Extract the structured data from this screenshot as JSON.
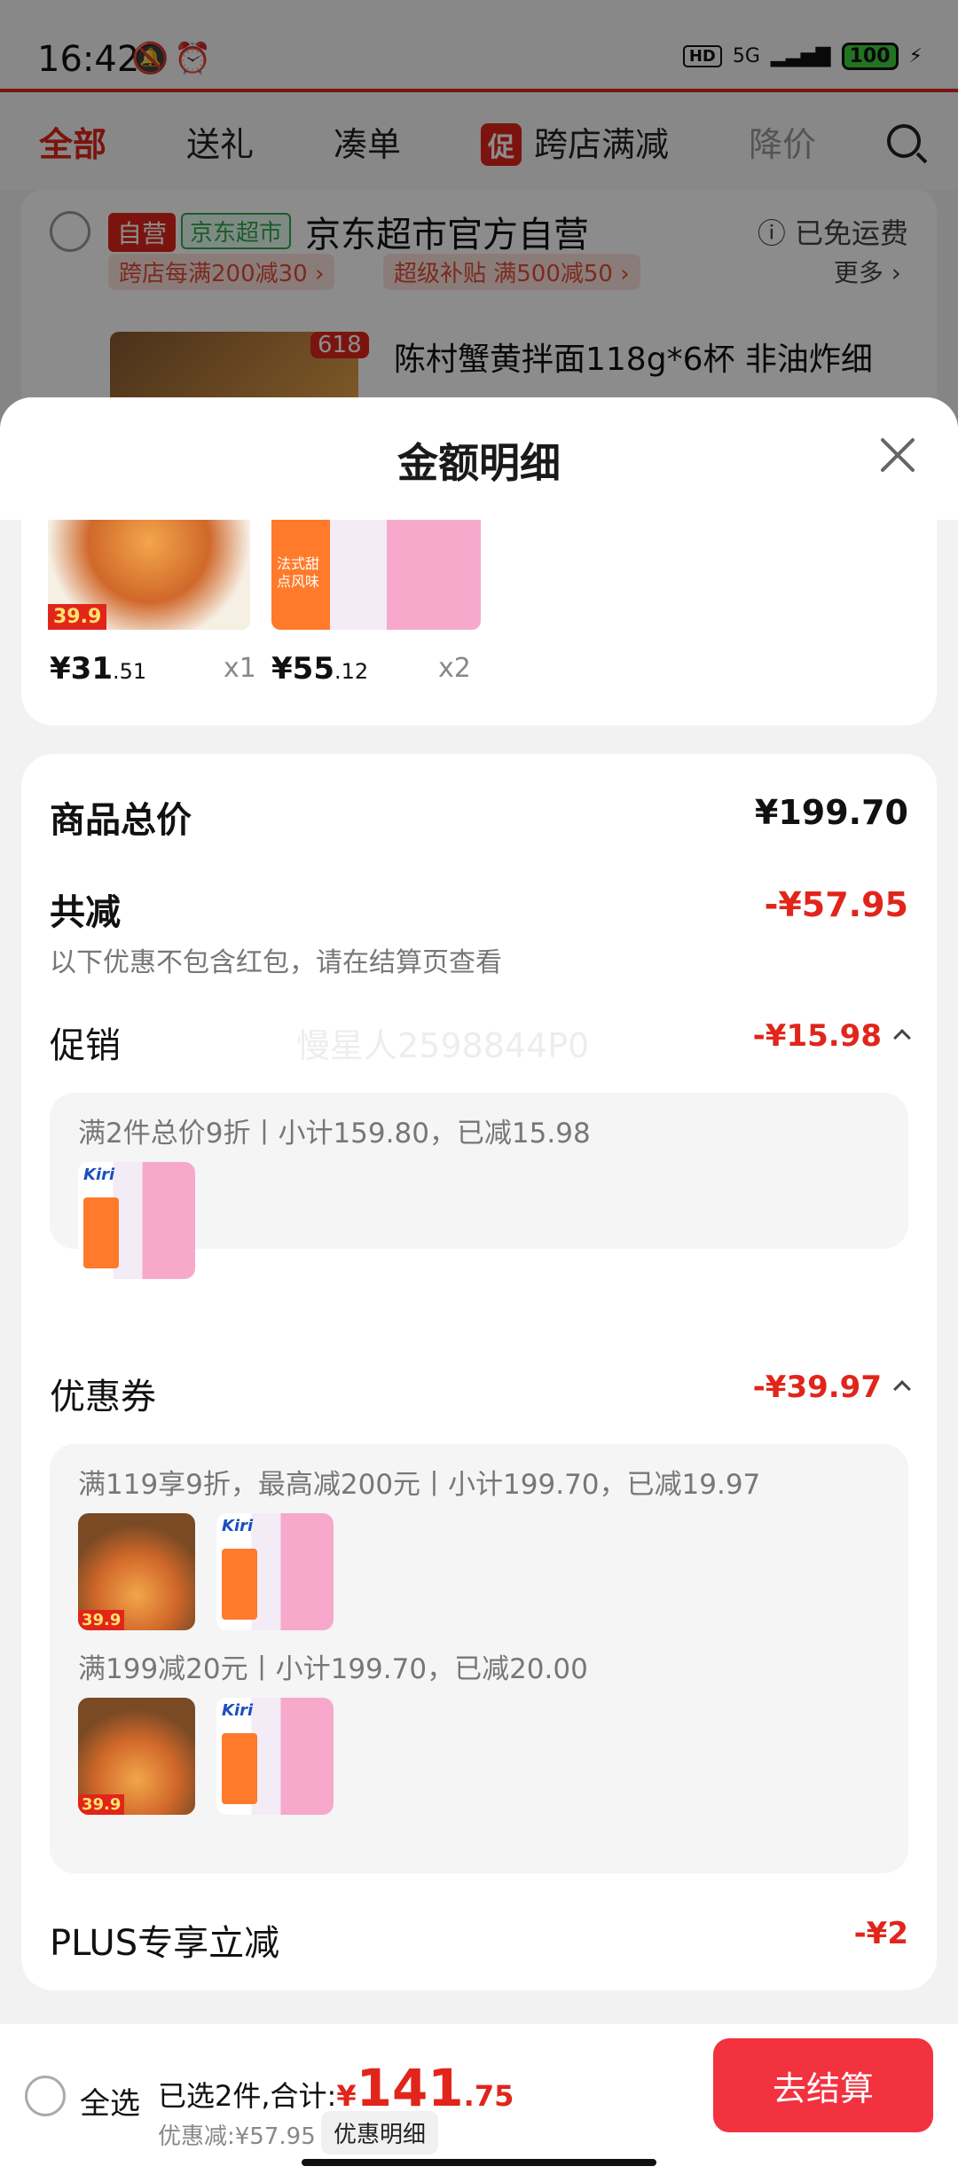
{
  "status": {
    "time": "16:42",
    "hd": "HD",
    "net": "5G",
    "battery": "100"
  },
  "tabs": [
    {
      "label": "全部"
    },
    {
      "label": "送礼"
    },
    {
      "label": "凑单"
    },
    {
      "label": "跨店满减",
      "badge": "促"
    },
    {
      "label": "降价"
    }
  ],
  "store": {
    "tag_self": "自营",
    "tag_jd": "京东超市",
    "name": "京东超市官方自营",
    "free_ship": "ⓘ 已免运费",
    "coupon1": "跨店每满200减30 ›",
    "coupon2": "超级补贴 满500减50 ›",
    "more": "更多 ›",
    "product_badge": "618",
    "product_title": "陈村蟹黄拌面118g*6杯 非油炸细"
  },
  "sheet": {
    "title": "金额明细",
    "goods": [
      {
        "price_int": "¥31",
        "price_dec": ".51",
        "qty": "x1",
        "tag": "39.9"
      },
      {
        "price_int": "¥55",
        "price_dec": ".12",
        "qty": "x2",
        "tag": "法式甜点风味"
      }
    ],
    "total_label": "商品总价",
    "total_value": "¥199.70",
    "reduce_label": "共减",
    "reduce_value": "-¥57.95",
    "reduce_note": "以下优惠不包含红包，请在结算页查看",
    "watermark": "慢星人2598844P0",
    "promo_label": "促销",
    "promo_value": "-¥15.98",
    "promo_rule": "满2件总价9折丨小计159.80，已减15.98",
    "coupon_label": "优惠券",
    "coupon_value": "-¥39.97",
    "coupon_rule1": "满119享9折，最高减200元丨小计199.70，已减19.97",
    "coupon_rule2": "满199减20元丨小计199.70，已减20.00",
    "plus_label": "PLUS专享立减",
    "plus_value": "-¥2",
    "kiri_logo": "Kiri",
    "noodle_tag": "39.9"
  },
  "footer": {
    "select_all": "全选",
    "summary_prefix": "已选2件,合计:",
    "currency": "¥",
    "total_int": "141",
    "total_dec": ".75",
    "discount": "优惠减:¥57.95",
    "detail_btn": "优惠明细",
    "checkout": "去结算"
  },
  "colors": {
    "accent": "#e1251b",
    "checkout": "#f2323f",
    "green": "#2ca94f"
  }
}
